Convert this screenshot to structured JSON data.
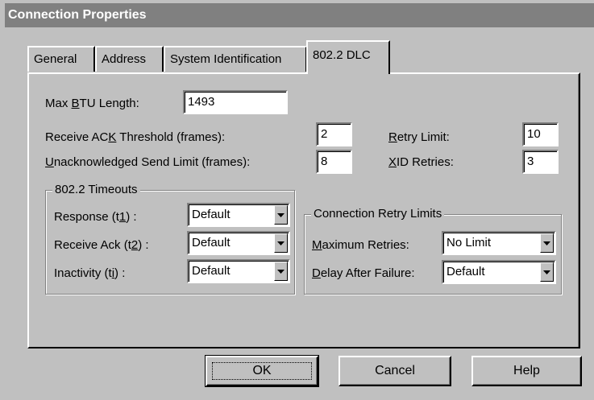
{
  "window": {
    "title": "Connection Properties"
  },
  "tabs": [
    {
      "label": "General"
    },
    {
      "label": "Address"
    },
    {
      "label": "System Identification"
    },
    {
      "label": "802.2 DLC",
      "active": true
    }
  ],
  "fields": {
    "max_btu": {
      "label_pre": "Max ",
      "label_u": "B",
      "label_post": "TU Length:",
      "value": "1493"
    },
    "receive_ack_threshold": {
      "label_pre": "Receive AC",
      "label_u": "K",
      "label_post": " Threshold (frames):",
      "value": "2"
    },
    "unack_send_limit": {
      "label_pre": "",
      "label_u": "U",
      "label_post": "nacknowledged Send Limit (frames):",
      "value": "8"
    },
    "retry_limit": {
      "label_pre": "",
      "label_u": "R",
      "label_post": "etry Limit:",
      "value": "10"
    },
    "xid_retries": {
      "label_pre": "",
      "label_u": "X",
      "label_post": "ID Retries:",
      "value": "3"
    }
  },
  "timeouts": {
    "title": "802.2 Timeouts",
    "response": {
      "label_pre": "Response (t",
      "label_u": "1",
      "label_post": ") :",
      "value": "Default"
    },
    "receive_ack": {
      "label_pre": "Receive Ack (t",
      "label_u": "2",
      "label_post": ") :",
      "value": "Default"
    },
    "inactivity": {
      "label_pre": "Inactivity (t",
      "label_u": "i",
      "label_post": ") :",
      "value": "Default"
    }
  },
  "retry_limits": {
    "title": "Connection Retry Limits",
    "max_retries": {
      "label_pre": "",
      "label_u": "M",
      "label_post": "aximum Retries:",
      "value": "No Limit"
    },
    "delay_after_failure": {
      "label_pre": "",
      "label_u": "D",
      "label_post": "elay After Failure:",
      "value": "Default"
    }
  },
  "buttons": {
    "ok": "OK",
    "cancel": "Cancel",
    "help": "Help"
  },
  "icons": {
    "dropdown": "chevron-down-icon"
  }
}
